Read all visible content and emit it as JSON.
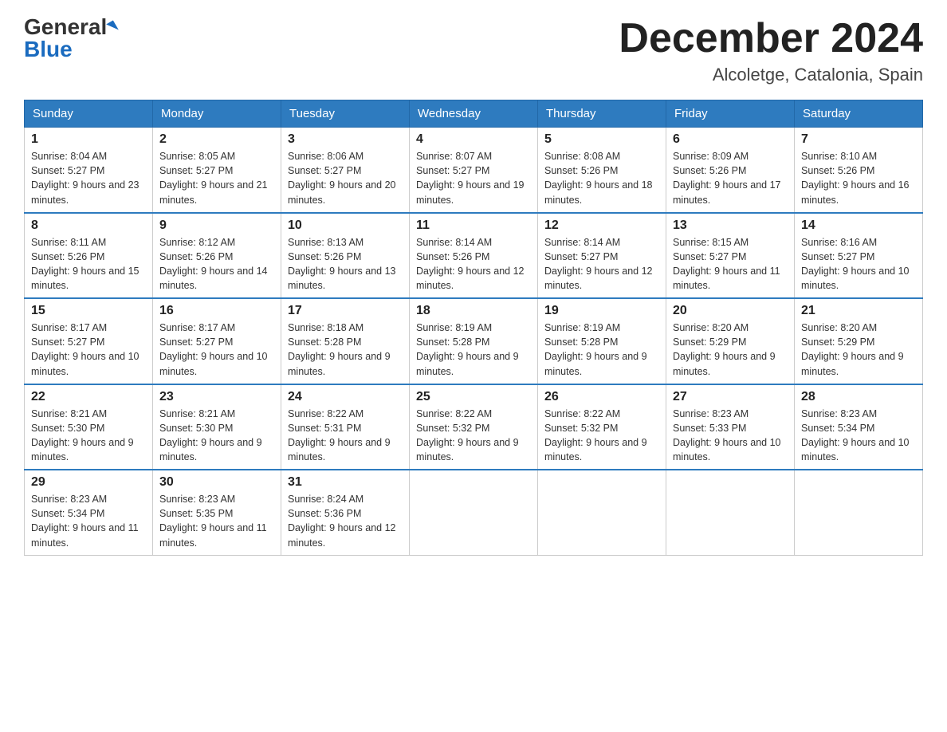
{
  "header": {
    "logo_general": "General",
    "logo_blue": "Blue",
    "month_title": "December 2024",
    "location": "Alcoletge, Catalonia, Spain"
  },
  "days_of_week": [
    "Sunday",
    "Monday",
    "Tuesday",
    "Wednesday",
    "Thursday",
    "Friday",
    "Saturday"
  ],
  "weeks": [
    [
      {
        "day": "1",
        "sunrise": "8:04 AM",
        "sunset": "5:27 PM",
        "daylight": "9 hours and 23 minutes."
      },
      {
        "day": "2",
        "sunrise": "8:05 AM",
        "sunset": "5:27 PM",
        "daylight": "9 hours and 21 minutes."
      },
      {
        "day": "3",
        "sunrise": "8:06 AM",
        "sunset": "5:27 PM",
        "daylight": "9 hours and 20 minutes."
      },
      {
        "day": "4",
        "sunrise": "8:07 AM",
        "sunset": "5:27 PM",
        "daylight": "9 hours and 19 minutes."
      },
      {
        "day": "5",
        "sunrise": "8:08 AM",
        "sunset": "5:26 PM",
        "daylight": "9 hours and 18 minutes."
      },
      {
        "day": "6",
        "sunrise": "8:09 AM",
        "sunset": "5:26 PM",
        "daylight": "9 hours and 17 minutes."
      },
      {
        "day": "7",
        "sunrise": "8:10 AM",
        "sunset": "5:26 PM",
        "daylight": "9 hours and 16 minutes."
      }
    ],
    [
      {
        "day": "8",
        "sunrise": "8:11 AM",
        "sunset": "5:26 PM",
        "daylight": "9 hours and 15 minutes."
      },
      {
        "day": "9",
        "sunrise": "8:12 AM",
        "sunset": "5:26 PM",
        "daylight": "9 hours and 14 minutes."
      },
      {
        "day": "10",
        "sunrise": "8:13 AM",
        "sunset": "5:26 PM",
        "daylight": "9 hours and 13 minutes."
      },
      {
        "day": "11",
        "sunrise": "8:14 AM",
        "sunset": "5:26 PM",
        "daylight": "9 hours and 12 minutes."
      },
      {
        "day": "12",
        "sunrise": "8:14 AM",
        "sunset": "5:27 PM",
        "daylight": "9 hours and 12 minutes."
      },
      {
        "day": "13",
        "sunrise": "8:15 AM",
        "sunset": "5:27 PM",
        "daylight": "9 hours and 11 minutes."
      },
      {
        "day": "14",
        "sunrise": "8:16 AM",
        "sunset": "5:27 PM",
        "daylight": "9 hours and 10 minutes."
      }
    ],
    [
      {
        "day": "15",
        "sunrise": "8:17 AM",
        "sunset": "5:27 PM",
        "daylight": "9 hours and 10 minutes."
      },
      {
        "day": "16",
        "sunrise": "8:17 AM",
        "sunset": "5:27 PM",
        "daylight": "9 hours and 10 minutes."
      },
      {
        "day": "17",
        "sunrise": "8:18 AM",
        "sunset": "5:28 PM",
        "daylight": "9 hours and 9 minutes."
      },
      {
        "day": "18",
        "sunrise": "8:19 AM",
        "sunset": "5:28 PM",
        "daylight": "9 hours and 9 minutes."
      },
      {
        "day": "19",
        "sunrise": "8:19 AM",
        "sunset": "5:28 PM",
        "daylight": "9 hours and 9 minutes."
      },
      {
        "day": "20",
        "sunrise": "8:20 AM",
        "sunset": "5:29 PM",
        "daylight": "9 hours and 9 minutes."
      },
      {
        "day": "21",
        "sunrise": "8:20 AM",
        "sunset": "5:29 PM",
        "daylight": "9 hours and 9 minutes."
      }
    ],
    [
      {
        "day": "22",
        "sunrise": "8:21 AM",
        "sunset": "5:30 PM",
        "daylight": "9 hours and 9 minutes."
      },
      {
        "day": "23",
        "sunrise": "8:21 AM",
        "sunset": "5:30 PM",
        "daylight": "9 hours and 9 minutes."
      },
      {
        "day": "24",
        "sunrise": "8:22 AM",
        "sunset": "5:31 PM",
        "daylight": "9 hours and 9 minutes."
      },
      {
        "day": "25",
        "sunrise": "8:22 AM",
        "sunset": "5:32 PM",
        "daylight": "9 hours and 9 minutes."
      },
      {
        "day": "26",
        "sunrise": "8:22 AM",
        "sunset": "5:32 PM",
        "daylight": "9 hours and 9 minutes."
      },
      {
        "day": "27",
        "sunrise": "8:23 AM",
        "sunset": "5:33 PM",
        "daylight": "9 hours and 10 minutes."
      },
      {
        "day": "28",
        "sunrise": "8:23 AM",
        "sunset": "5:34 PM",
        "daylight": "9 hours and 10 minutes."
      }
    ],
    [
      {
        "day": "29",
        "sunrise": "8:23 AM",
        "sunset": "5:34 PM",
        "daylight": "9 hours and 11 minutes."
      },
      {
        "day": "30",
        "sunrise": "8:23 AM",
        "sunset": "5:35 PM",
        "daylight": "9 hours and 11 minutes."
      },
      {
        "day": "31",
        "sunrise": "8:24 AM",
        "sunset": "5:36 PM",
        "daylight": "9 hours and 12 minutes."
      },
      null,
      null,
      null,
      null
    ]
  ]
}
